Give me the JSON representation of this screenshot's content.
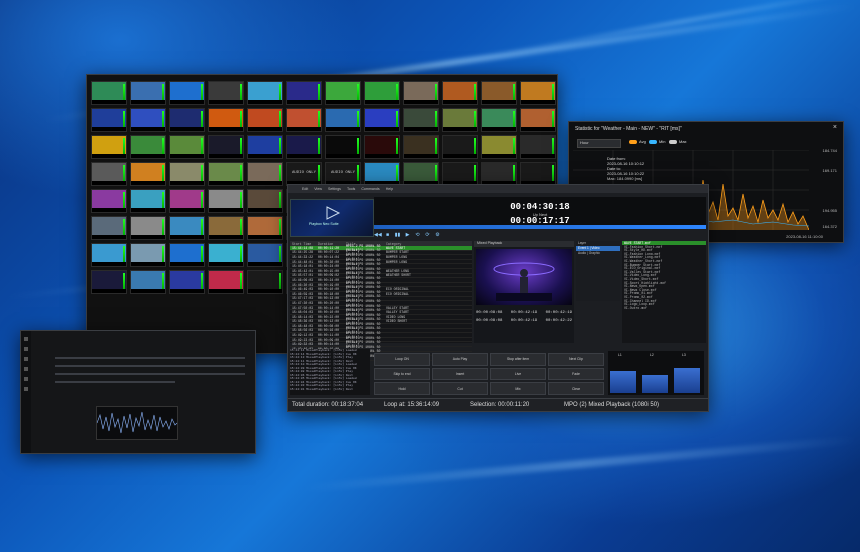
{
  "multiviewer": {
    "tiles": [
      {
        "c": "#2e8b57",
        "t": ""
      },
      {
        "c": "#3a6fb0",
        "t": ""
      },
      {
        "c": "#1e6fcf",
        "t": ""
      },
      {
        "c": "#3a3a3a",
        "t": ""
      },
      {
        "c": "#3aa0d0",
        "t": ""
      },
      {
        "c": "#2a2a8a",
        "t": ""
      },
      {
        "c": "#3ca83c",
        "t": ""
      },
      {
        "c": "#2e9e3a",
        "t": ""
      },
      {
        "c": "#7a6a5a",
        "t": ""
      },
      {
        "c": "#b05a20",
        "t": ""
      },
      {
        "c": "#8a5a2a",
        "t": ""
      },
      {
        "c": "#c07a20",
        "t": ""
      },
      {
        "c": "#1f3e9a",
        "t": ""
      },
      {
        "c": "#2f4fbf",
        "t": ""
      },
      {
        "c": "#1e2c70",
        "t": ""
      },
      {
        "c": "#d05a10",
        "t": ""
      },
      {
        "c": "#c04a20",
        "t": ""
      },
      {
        "c": "#c05030",
        "t": ""
      },
      {
        "c": "#2a6ab0",
        "t": ""
      },
      {
        "c": "#2a3ec0",
        "t": ""
      },
      {
        "c": "#3a4a3a",
        "t": ""
      },
      {
        "c": "#6a7a3a",
        "t": ""
      },
      {
        "c": "#3a8a5a",
        "t": ""
      },
      {
        "c": "#b06030",
        "t": ""
      },
      {
        "c": "#d0a010",
        "t": ""
      },
      {
        "c": "#3a8a3a",
        "t": ""
      },
      {
        "c": "#5a8a3a",
        "t": ""
      },
      {
        "c": "#1a1a2a",
        "t": ""
      },
      {
        "c": "#1e3ea0",
        "t": ""
      },
      {
        "c": "#1a1a4a",
        "t": ""
      },
      {
        "c": "#0a0a0a",
        "t": ""
      },
      {
        "c": "#2a0a0a",
        "t": ""
      },
      {
        "c": "#3a3020",
        "t": ""
      },
      {
        "c": "#1a1a1a",
        "t": ""
      },
      {
        "c": "#8a8a30",
        "t": ""
      },
      {
        "c": "#2a2a2a",
        "t": ""
      },
      {
        "c": "#5a5a5a",
        "t": ""
      },
      {
        "c": "#d08020",
        "t": ""
      },
      {
        "c": "#8a8a6a",
        "t": ""
      },
      {
        "c": "#6a8a4a",
        "t": ""
      },
      {
        "c": "#7a6a5a",
        "t": ""
      },
      {
        "c": "#1a1a1a",
        "t": "AUDIO ONLY"
      },
      {
        "c": "#1a1a1a",
        "t": "AUDIO ONLY"
      },
      {
        "c": "#2a8ac0",
        "t": ""
      },
      {
        "c": "#3a5a3a",
        "t": ""
      },
      {
        "c": "#1a1a1a",
        "t": ""
      },
      {
        "c": "#2a2a2a",
        "t": ""
      },
      {
        "c": "#1a1a1a",
        "t": ""
      },
      {
        "c": "#8a3aa0",
        "t": ""
      },
      {
        "c": "#3aa0c0",
        "t": ""
      },
      {
        "c": "#a03a8a",
        "t": ""
      },
      {
        "c": "#8a8a8a",
        "t": ""
      },
      {
        "c": "#5a4a3a",
        "t": ""
      },
      {
        "c": "#c0a070",
        "t": ""
      },
      {
        "c": "#9a8a7a",
        "t": ""
      },
      {
        "c": "#c05aa0",
        "t": ""
      },
      {
        "c": "#6a4a3a",
        "t": ""
      },
      {
        "c": "#9a7aa0",
        "t": ""
      },
      {
        "c": "#8a2a2a",
        "t": ""
      },
      {
        "c": "#6a6a6a",
        "t": ""
      },
      {
        "c": "#5a6a7a",
        "t": ""
      },
      {
        "c": "#8a8a8a",
        "t": ""
      },
      {
        "c": "#3a8ac0",
        "t": ""
      },
      {
        "c": "#8a6a3a",
        "t": ""
      },
      {
        "c": "#b06a3a",
        "t": ""
      },
      {
        "c": "#2a4a8a",
        "t": ""
      },
      {
        "c": "#1a1a1a",
        "t": "AUDIO ONLY"
      },
      {
        "c": "#1a1a1a",
        "t": "AUDIO ONLY"
      },
      {
        "c": "#1a1a1a",
        "t": ""
      },
      {
        "c": "#2a2a2a",
        "t": ""
      },
      {
        "c": "#1a1a1a",
        "t": ""
      },
      {
        "c": "#1a1a1a",
        "t": ""
      },
      {
        "c": "#3a9ad0",
        "t": ""
      },
      {
        "c": "#7a9ab0",
        "t": ""
      },
      {
        "c": "#1e6fcf",
        "t": ""
      },
      {
        "c": "#3ab0d0",
        "t": ""
      },
      {
        "c": "#2a5aa0",
        "t": ""
      },
      {
        "c": "#1a1a1a",
        "t": ""
      },
      {
        "c": "#3a3a3a",
        "t": ""
      },
      {
        "c": "#1a1a1a",
        "t": ""
      },
      {
        "c": "#2a2a2a",
        "t": ""
      },
      {
        "c": "#1a1a1a",
        "t": ""
      },
      {
        "c": "#1a1a1a",
        "t": ""
      },
      {
        "c": "#1a1a1a",
        "t": ""
      },
      {
        "c": "#1a1a3a",
        "t": ""
      },
      {
        "c": "#3a7ab0",
        "t": ""
      },
      {
        "c": "#2a3aa0",
        "t": ""
      },
      {
        "c": "#c02a4a",
        "t": ""
      },
      {
        "c": "#1a1a1a",
        "t": ""
      },
      {
        "c": "#1a1a1a",
        "t": ""
      },
      {
        "c": "#1a1a1a",
        "t": ""
      },
      {
        "c": "#1a1a1a",
        "t": ""
      },
      {
        "c": "#1a1a1a",
        "t": ""
      },
      {
        "c": "#1a1a1a",
        "t": ""
      },
      {
        "c": "#1a1a1a",
        "t": ""
      },
      {
        "c": "#1a1a1a",
        "t": ""
      }
    ]
  },
  "stats": {
    "title": "Statistic for \"Weather - Main - NEW\" - \"RIT [ms]\"",
    "close": "×",
    "select": "Hour",
    "toggles": [
      "Avg",
      "Min",
      "Max"
    ],
    "info": [
      "Date from:",
      "2023-08-16 10:10:12",
      "Date to:",
      "2023-08-16 10:10:22",
      "Max: 184.0990 [ms]"
    ],
    "y_labels": [
      "184.744",
      "169.171",
      "194.955",
      "164.372"
    ],
    "footer": "2023-08-16 11:10:00",
    "colors": {
      "accent": "#ff9f1a",
      "min": "#38b6ff"
    }
  },
  "playout": {
    "window_title": "Airbox Player",
    "menu": [
      "Edit",
      "View",
      "Settings",
      "Tools",
      "Commands",
      "Help"
    ],
    "logo_text": "Playbox Neo Suite",
    "counter_main": "00:04:30:18",
    "up_next_label": "Up Next",
    "counter_next": "00:00:17:17",
    "transport_icons": [
      "◀◀",
      "■",
      "▮▮",
      "▶",
      "⟲",
      "⟳",
      "⚙"
    ],
    "columns": [
      "Start Time",
      "Duration",
      "Title",
      "Category"
    ],
    "rows": [
      {
        "start": "15:44:14:08",
        "dur": "00:00:11:20",
        "title": "MPEG-2 PS 1080i 50 [4 Bit]",
        "cat": "WAVE START",
        "active": true
      },
      {
        "start": "15:44:25:28",
        "dur": "00:00:07:22",
        "title": "MPEG-2 PS 1080i 50 [4 Bit]",
        "cat": "BUMPER START",
        "active": false
      },
      {
        "start": "15:44:33:22",
        "dur": "00:00:14:04",
        "title": "MPEG-2 PS 1080i 50 [4 Bit]",
        "cat": "BUMPER LONG",
        "active": false
      },
      {
        "start": "15:44:48:01",
        "dur": "00:00:30:00",
        "title": "MPEG-2 PS 1080i 50 [4 Bit]",
        "cat": "BUMPER LONG",
        "active": false
      },
      {
        "start": "15:45:18:01",
        "dur": "00:00:24:00",
        "title": "MPEG-2 PS 1080i 50 [4 Bit]",
        "cat": "",
        "active": false
      },
      {
        "start": "15:45:42:01",
        "dur": "00:00:15:00",
        "title": "MPEG-2 PS 1080i 50 [4 Bit]",
        "cat": "WEATHER LONG",
        "active": false
      },
      {
        "start": "15:45:57:01",
        "dur": "00:00:09:02",
        "title": "MPEG-2 PS 1080i 50 [4 Bit]",
        "cat": "WEATHER SHORT",
        "active": false
      },
      {
        "start": "15:46:06:03",
        "dur": "00:00:24:00",
        "title": "MPEG-2 PS 1080i 50 [4 Bit]",
        "cat": "",
        "active": false
      },
      {
        "start": "15:46:30:03",
        "dur": "00:00:19:00",
        "title": "MPEG-2 PS 1080i 50 [4 Bit]",
        "cat": "",
        "active": false
      },
      {
        "start": "15:46:49:03",
        "dur": "00:00:10:00",
        "title": "MPEG-2 PS 1080i 50 [4 Bit]",
        "cat": "ECO ORIGINAL",
        "active": false
      },
      {
        "start": "15:46:59:03",
        "dur": "00:00:18:00",
        "title": "MPEG-2 PS 1080i 50 [4 Bit]",
        "cat": "ECO ORIGINAL",
        "active": false
      },
      {
        "start": "15:47:17:03",
        "dur": "00:00:13:00",
        "title": "MPEG-2 PS 1080i 50 [4 Bit]",
        "cat": "",
        "active": false
      },
      {
        "start": "15:47:30:03",
        "dur": "00:00:20:00",
        "title": "MPEG-2 PS 1080i 50 [4 Bit]",
        "cat": "",
        "active": false
      },
      {
        "start": "15:47:50:03",
        "dur": "00:00:14:00",
        "title": "MPEG-2 PS 1080i 50 [4 Bit]",
        "cat": "VALLEY START",
        "active": false
      },
      {
        "start": "15:48:04:03",
        "dur": "00:00:10:00",
        "title": "MPEG-2 PS 1080i 50 [4 Bit]",
        "cat": "VALLEY START",
        "active": false
      },
      {
        "start": "15:48:14:03",
        "dur": "00:00:22:00",
        "title": "MPEG-2 PS 1080i 50 [4 Bit]",
        "cat": "VIDEO LONG",
        "active": false
      },
      {
        "start": "15:48:36:03",
        "dur": "00:00:12:00",
        "title": "MPEG-2 PS 1080i 50 [4 Bit]",
        "cat": "VIDEO SHORT",
        "active": false
      },
      {
        "start": "15:48:48:03",
        "dur": "00:00:08:00",
        "title": "MPEG-2 PS 1080i 50 [4 Bit]",
        "cat": "",
        "active": false
      },
      {
        "start": "15:48:56:03",
        "dur": "00:00:16:00",
        "title": "MPEG-2 PS 1080i 50 [4 Bit]",
        "cat": "",
        "active": false
      },
      {
        "start": "15:49:12:03",
        "dur": "00:00:11:00",
        "title": "MPEG-2 PS 1080i 50 [4 Bit]",
        "cat": "",
        "active": false
      },
      {
        "start": "15:49:23:03",
        "dur": "00:00:09:00",
        "title": "MPEG-2 PS 1080i 50 [4 Bit]",
        "cat": "",
        "active": false
      },
      {
        "start": "15:49:32:03",
        "dur": "00:00:14:00",
        "title": "MPEG-2 PS 1080i 50 [4 Bit]",
        "cat": "",
        "active": false
      },
      {
        "start": "15:49:46:03",
        "dur": "00:00:19:00",
        "title": "MPEG-2 PS 1080i 50 [4 Bit]",
        "cat": "",
        "active": false
      },
      {
        "start": "15:50:05:03",
        "dur": "00:00:12:00",
        "title": "MPEG-2 PS 1080i 50 [4 Bit]",
        "cat": "",
        "active": false
      },
      {
        "start": "15:50:17:03",
        "dur": "00:00:10:00",
        "title": "MPEG-2 PS 1080i 50 [4 Bit]",
        "cat": "",
        "active": false
      }
    ],
    "preview_title": "Mixed Playback",
    "tc_in": "00:00:08:08",
    "tc_mid": "00:00:42:19",
    "tc_out": "00:00:42:19",
    "tc_in2": "00:00:08:08",
    "tc_mid2": "00:00:42:19",
    "tc_out2": "00:00:42:22",
    "mid_panel": [
      "Layer",
      "Event 1 | Video",
      "Audio | Graphic"
    ],
    "right_list": [
      "WAVE START.mxf",
      "VI-Fashion_Short.mxf",
      "VI-Style_HD.mxf",
      "VI-Fashion_Long.mxf",
      "VI-Weather_Long.mxf",
      "VI-Weather_Short.mxf",
      "VI-Bumper_Start.mxf",
      "VI-ECO_Original.mxf",
      "VI-Valley_Start.mxf",
      "VI-Video_Long.mxf",
      "VI-Video_Short.mxf",
      "VI-Sport_Highlight.mxf",
      "VI-News_Open.mxf",
      "VI-News_Close.mxf",
      "VI-Promo_01.mxf",
      "VI-Promo_02.mxf",
      "VI-Channel_ID.mxf",
      "VI-Logo_Loop.mxf",
      "VI-Outro.mxf"
    ],
    "buttons": [
      "Loop ON",
      "Auto Play",
      "Stop after item",
      "Next Clip",
      "Skip to end",
      "Insert",
      "Live",
      "Fade",
      "Hold",
      "Cut",
      "Mix",
      "Clear"
    ],
    "meter_labels": [
      "L1",
      "L2",
      "L3"
    ],
    "meter_levels": [
      0.55,
      0.45,
      0.62
    ],
    "status": {
      "total": "Total duration: 00:18:37:04",
      "loop": "Loop at: 15:36:14:09",
      "selection": "Selection: 00:00:11:20",
      "mode": "MPO (2) Mixed Playback (1080i 50)"
    },
    "log_lines": [
      "15:44:14 MixedPlayback: [info] Loaded",
      "15:44:14 MixedPlayback: [info] Cue OK",
      "15:44:13 MixedPlayback: [info] Play",
      "15:44:11 MixedPlayback: [info] Next",
      "15:44:10 MixedPlayback: [info] Loaded",
      "15:44:09 MixedPlayback: [info] Cue OK",
      "15:44:08 MixedPlayback: [info] Play",
      "15:44:06 MixedPlayback: [info] Next",
      "15:44:05 MixedPlayback: [info] Loaded",
      "15:44:04 MixedPlayback: [info] Cue OK",
      "15:44:03 MixedPlayback: [info] Play",
      "15:44:01 MixedPlayback: [info] Next"
    ]
  }
}
